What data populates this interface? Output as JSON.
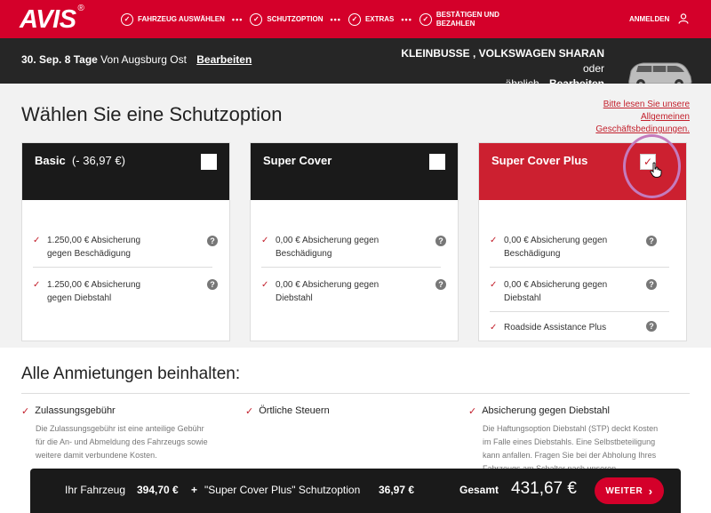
{
  "header": {
    "logo": "AVIS",
    "logo_mark": "®",
    "steps": [
      {
        "label": "FAHRZEUG AUSWÄHLEN"
      },
      {
        "label": "SCHUTZOPTION"
      },
      {
        "label": "EXTRAS"
      },
      {
        "label_line1": "BESTÄTIGEN UND",
        "label_line2": "BEZAHLEN"
      }
    ],
    "dots": "•••",
    "login": "ANMELDEN",
    "check_glyph": "✓"
  },
  "trip": {
    "date": "30. Sep.",
    "duration": "8 Tage",
    "location": "Von Augsburg Ost",
    "edit": "Bearbeiten"
  },
  "vehicle": {
    "name": "KLEINBUSSE , VOLKSWAGEN SHARAN",
    "suffix1": "oder",
    "suffix2": "ähnlich",
    "edit": "Bearbeiten"
  },
  "page": {
    "title": "Wählen Sie eine Schutzoption",
    "terms_line1": "Bitte lesen Sie unsere",
    "terms_line2": "Allgemeinen",
    "terms_line3": "Geschäftsbedingungen."
  },
  "options": [
    {
      "name": "Basic",
      "price": "(- 36,97 €)",
      "selected": false,
      "features": [
        {
          "line1": "1.250,00 € Absicherung",
          "line2": "gegen Beschädigung"
        },
        {
          "line1": "1.250,00 € Absicherung",
          "line2": "gegen Diebstahl"
        }
      ]
    },
    {
      "name": "Super Cover",
      "selected": false,
      "features": [
        {
          "line1": "0,00 € Absicherung gegen",
          "line2": "Beschädigung"
        },
        {
          "line1": "0,00 € Absicherung gegen",
          "line2": "Diebstahl"
        }
      ]
    },
    {
      "name": "Super Cover Plus",
      "selected": true,
      "features": [
        {
          "line1": "0,00 € Absicherung gegen",
          "line2": "Beschädigung"
        },
        {
          "line1": "0,00 € Absicherung gegen",
          "line2": "Diebstahl"
        },
        {
          "line1": "Roadside Assistance Plus",
          "line2": ""
        }
      ]
    }
  ],
  "tick_glyph": "✓",
  "help_glyph": "?",
  "included": {
    "title": "Alle Anmietungen beinhalten:",
    "items": [
      {
        "title": "Zulassungsgebühr",
        "desc1": "Die Zulassungsgebühr ist eine anteilige Gebühr",
        "desc2": "für die An- und Abmeldung des Fahrzeugs sowie",
        "desc3": "weitere damit verbundene Kosten.",
        "desc4": ""
      },
      {
        "title": "Örtliche Steuern",
        "desc1": "",
        "desc2": "",
        "desc3": "",
        "desc4": ""
      },
      {
        "title": "Absicherung gegen Diebstahl",
        "desc1": "Die Haftungsoption Diebstahl (STP) deckt Kosten",
        "desc2": "im Falle eines Diebstahls. Eine Selbstbeteiligung",
        "desc3": "kann anfallen. Fragen Sie bei der Abholung Ihres",
        "desc4": "Fahrzeugs am Schalter nach unseren"
      }
    ]
  },
  "footer": {
    "vehicle_label": "Ihr Fahrzeug",
    "vehicle_price": "394,70 €",
    "plus": "+",
    "option_label": "\"Super Cover Plus\" Schutzoption",
    "option_price": "36,97 €",
    "total_label": "Gesamt",
    "total": "431,67 €",
    "cta": "WEITER",
    "cta_icon": "›"
  },
  "colors": {
    "brand_red": "#d4002a",
    "selected_card": "#cc2030",
    "dark": "#1a1a1a",
    "highlight_ring": "#c47bbd"
  }
}
